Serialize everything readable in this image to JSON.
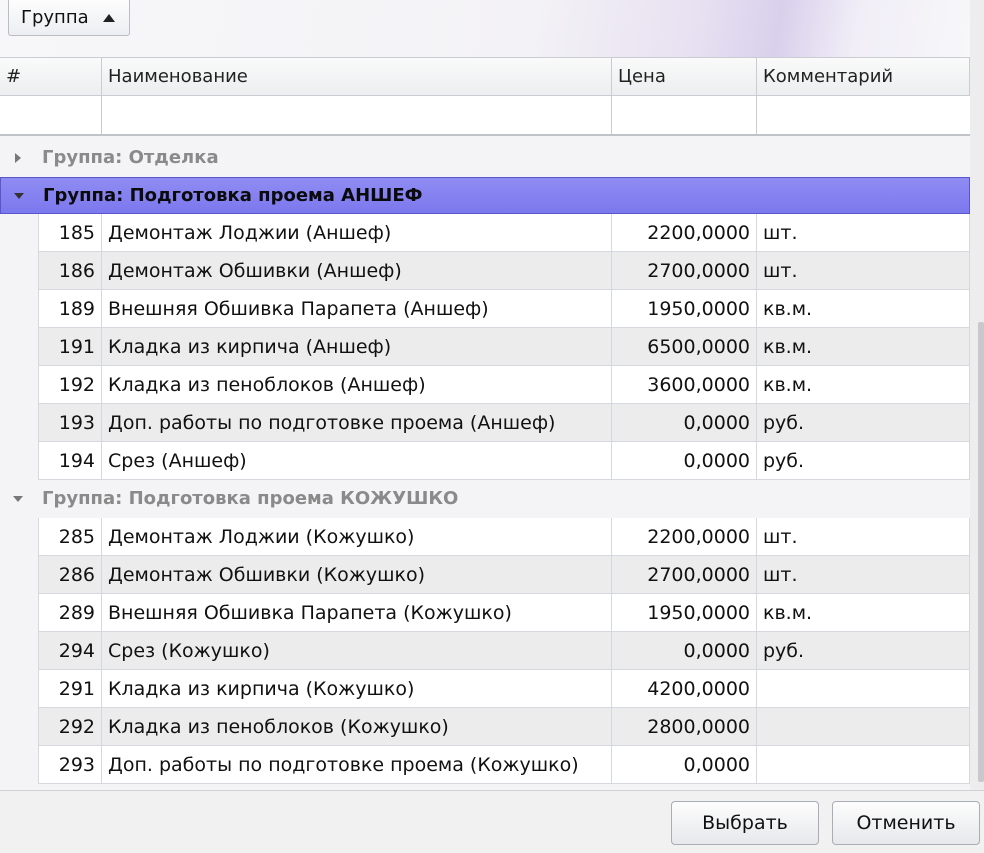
{
  "toolbar": {
    "group_button_label": "Группа"
  },
  "columns": {
    "num": "#",
    "name": "Наименование",
    "price": "Цена",
    "comment": "Комментарий"
  },
  "groups": [
    {
      "label": "Группа: Отделка",
      "expanded": false,
      "selected": false,
      "rows": []
    },
    {
      "label": "Группа: Подготовка проема АНШЕФ",
      "expanded": true,
      "selected": true,
      "rows": [
        {
          "id": "185",
          "name": "Демонтаж Лоджии (Аншеф)",
          "price": "2200,0000",
          "comment": "шт."
        },
        {
          "id": "186",
          "name": "Демонтаж Обшивки (Аншеф)",
          "price": "2700,0000",
          "comment": "шт."
        },
        {
          "id": "189",
          "name": "Внешняя Обшивка Парапета (Аншеф)",
          "price": "1950,0000",
          "comment": "кв.м."
        },
        {
          "id": "191",
          "name": "Кладка из кирпича (Аншеф)",
          "price": "6500,0000",
          "comment": "кв.м."
        },
        {
          "id": "192",
          "name": "Кладка из пеноблоков (Аншеф)",
          "price": "3600,0000",
          "comment": "кв.м."
        },
        {
          "id": "193",
          "name": "Доп. работы по подготовке проема (Аншеф)",
          "price": "0,0000",
          "comment": "руб."
        },
        {
          "id": "194",
          "name": "Срез (Аншеф)",
          "price": "0,0000",
          "comment": "руб."
        }
      ]
    },
    {
      "label": "Группа: Подготовка проема КОЖУШКО",
      "expanded": true,
      "selected": false,
      "rows": [
        {
          "id": "285",
          "name": "Демонтаж Лоджии (Кожушко)",
          "price": "2200,0000",
          "comment": "шт."
        },
        {
          "id": "286",
          "name": "Демонтаж Обшивки (Кожушко)",
          "price": "2700,0000",
          "comment": "шт."
        },
        {
          "id": "289",
          "name": "Внешняя Обшивка Парапета (Кожушко)",
          "price": "1950,0000",
          "comment": "кв.м."
        },
        {
          "id": "294",
          "name": "Срез (Кожушко)",
          "price": "0,0000",
          "comment": "руб."
        },
        {
          "id": "291",
          "name": "Кладка из кирпича (Кожушко)",
          "price": "4200,0000",
          "comment": ""
        },
        {
          "id": "292",
          "name": "Кладка из пеноблоков (Кожушко)",
          "price": "2800,0000",
          "comment": ""
        },
        {
          "id": "293",
          "name": "Доп. работы по подготовке проема (Кожушко)",
          "price": "0,0000",
          "comment": ""
        }
      ]
    }
  ],
  "buttons": {
    "select": "Выбрать",
    "cancel": "Отменить"
  }
}
